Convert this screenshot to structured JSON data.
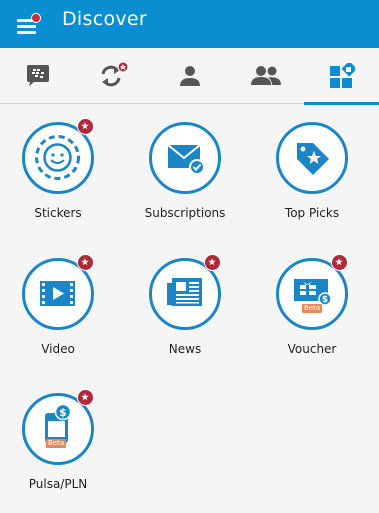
{
  "appbar": {
    "title": "Discover",
    "bg_color": "#0a8ed1"
  },
  "tabs": [
    {
      "name": "bbm-chats-icon",
      "active": false
    },
    {
      "name": "updates-icon",
      "active": false
    },
    {
      "name": "contact-icon",
      "active": false
    },
    {
      "name": "groups-icon",
      "active": false
    },
    {
      "name": "discover-icon",
      "active": true
    }
  ],
  "items": [
    {
      "label": "Stickers",
      "icon": "stickers-icon",
      "badge": true
    },
    {
      "label": "Subscriptions",
      "icon": "subscriptions-icon",
      "badge": false
    },
    {
      "label": "Top Picks",
      "icon": "top-picks-icon",
      "badge": false
    },
    {
      "label": "Video",
      "icon": "video-icon",
      "badge": true
    },
    {
      "label": "News",
      "icon": "news-icon",
      "badge": true
    },
    {
      "label": "Voucher",
      "icon": "voucher-icon",
      "badge": true,
      "tag": "Beta"
    },
    {
      "label": "Pulsa/PLN",
      "icon": "pulsa-icon",
      "badge": true,
      "tag": "Beta"
    }
  ],
  "colors": {
    "accent": "#1a86c8",
    "badge": "#b0283a",
    "beta": "#e9875a"
  }
}
